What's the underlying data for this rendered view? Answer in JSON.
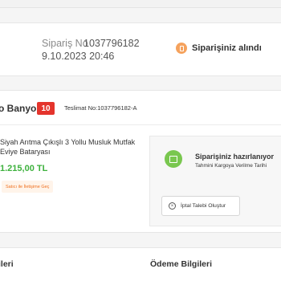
{
  "order": {
    "number_label": "Sipariş No",
    "number_value": "1037796182",
    "date": "9.10.2023 20:46",
    "status_text": "Siparişiniz alındı"
  },
  "package": {
    "seller_name": "o Banyo",
    "seller_score": "10",
    "delivery_number": "Teslimat No:1037796182-A",
    "product_title": "Siyah Arıtma Çıkışlı 3 Yollu Musluk Mutfak Eviye Bataryası",
    "product_price": "1.215,00 TL",
    "contact_seller_label": "Satıcı ile İletişime Geç",
    "status_title": "Siparişiniz hazırlanıyor",
    "status_subtitle": "Tahmini Kargoya Verilme Tarihi",
    "cancel_label": "İptal Talebi Oluştur"
  },
  "sections": {
    "delivery_title": "ileri",
    "payment_title": "Ödeme Bilgileri"
  },
  "icons": {
    "status_received": "bag-icon",
    "status_preparing": "package-icon",
    "cancel": "close-icon"
  },
  "colors": {
    "accent_orange": "#ef6f1f",
    "price_green": "#3db13d",
    "score_red": "#e4342c"
  }
}
